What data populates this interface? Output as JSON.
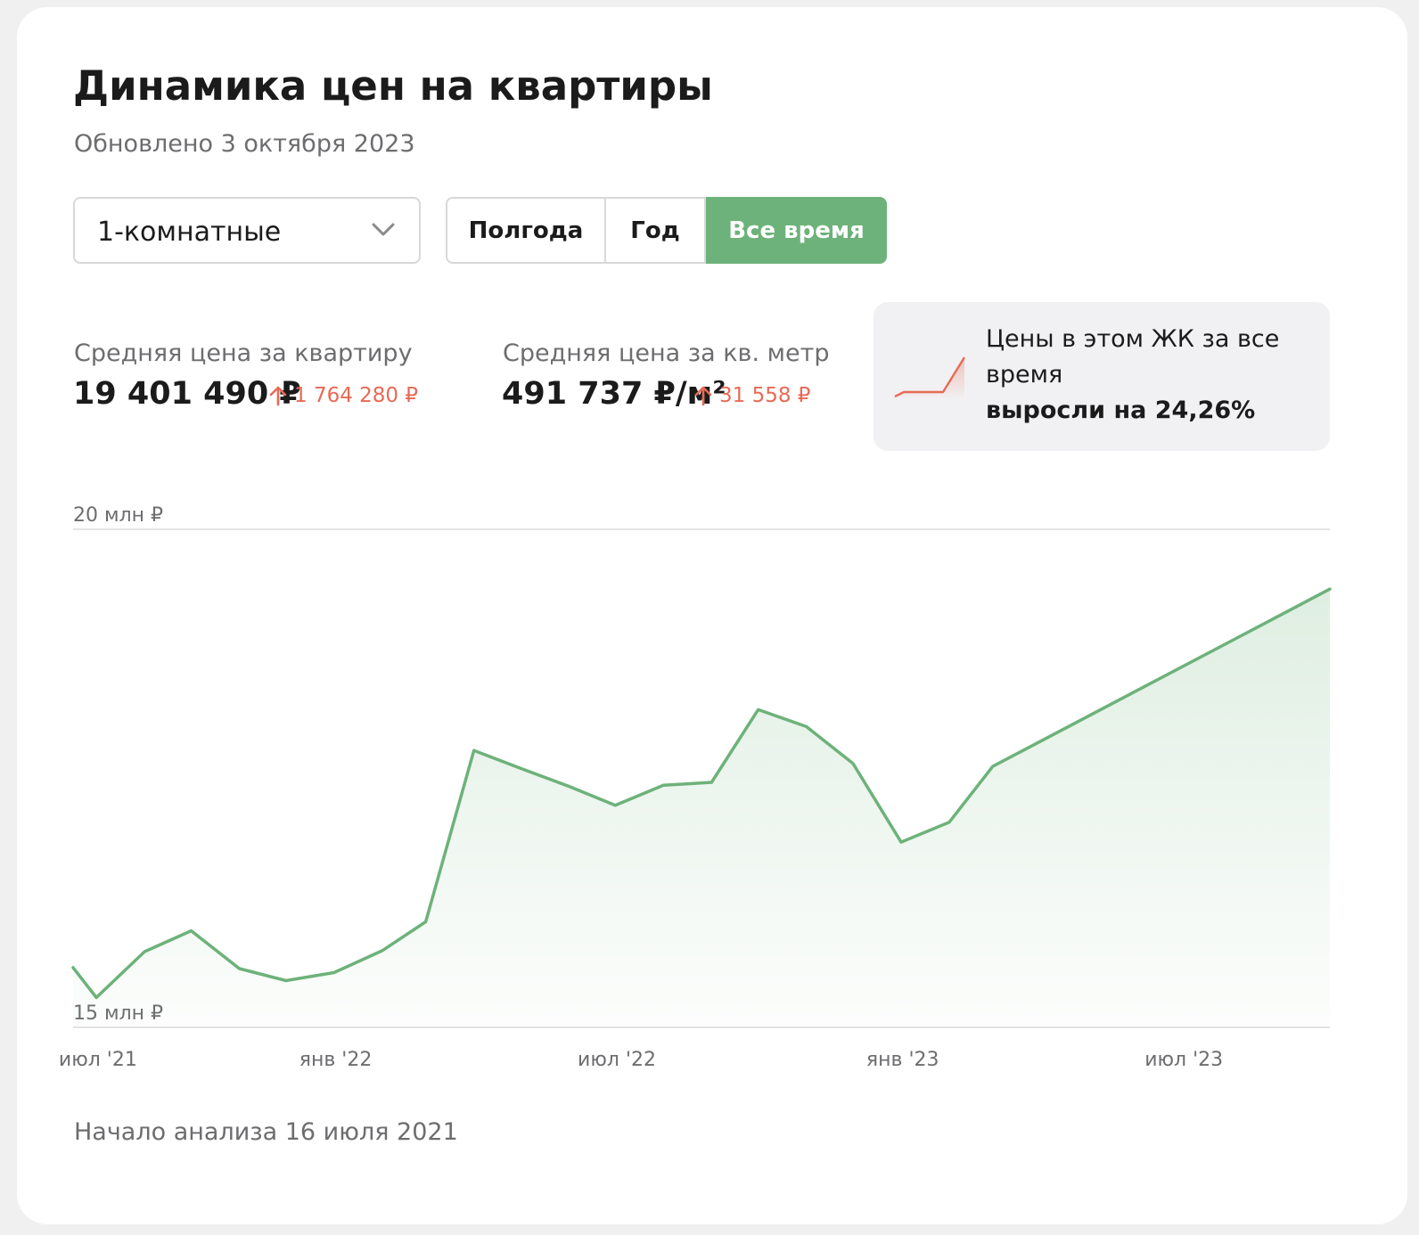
{
  "header": {
    "title": "Динамика цен на квартиры",
    "updated": "Обновлено 3 октября 2023"
  },
  "controls": {
    "room_select_value": "1-комнатные",
    "periods": [
      "Полгода",
      "Год",
      "Все время"
    ],
    "active_period": "Все время"
  },
  "stats": {
    "flat_price": {
      "label": "Средняя цена за квартиру",
      "value": "19 401 490 ₽",
      "delta": "1 764 280 ₽"
    },
    "sqm_price": {
      "label": "Средняя цена за кв. метр",
      "value": "491 737 ₽/м²",
      "delta": "31 558 ₽"
    },
    "delta_direction": "up"
  },
  "info": {
    "text": "Цены в этом ЖК за все время",
    "strong": "выросли на 24,26%"
  },
  "colors": {
    "accent": "#6db27a",
    "up": "#e86a55",
    "muted": "#6d6d70",
    "text": "#1b1b1c"
  },
  "chart_data": {
    "type": "area",
    "ylim": [
      15,
      20
    ],
    "y_tick_labels": [
      "20 млн ₽",
      "15 млн ₽"
    ],
    "x_tick_labels": [
      "июл '21",
      "янв '22",
      "июл '22",
      "янв '23",
      "июл '23"
    ],
    "xlim": [
      "2021-07-16",
      "2023-10-03"
    ],
    "x_ticks": [
      "2021-08-01",
      "2022-01-01",
      "2022-07-01",
      "2023-01-01",
      "2023-07-01"
    ],
    "x": [
      "2021-07-16",
      "2021-07-31",
      "2021-08-31",
      "2021-09-30",
      "2021-10-31",
      "2021-11-30",
      "2021-12-31",
      "2022-01-31",
      "2022-02-28",
      "2022-03-31",
      "2022-04-30",
      "2022-05-31",
      "2022-06-30",
      "2022-07-31",
      "2022-08-31",
      "2022-09-30",
      "2022-10-31",
      "2022-11-30",
      "2022-12-31",
      "2023-01-31",
      "2023-02-28",
      "2023-10-03"
    ],
    "values": [
      15.6,
      15.3,
      15.76,
      15.97,
      15.59,
      15.47,
      15.55,
      15.77,
      16.06,
      17.78,
      17.6,
      17.42,
      17.23,
      17.43,
      17.46,
      18.19,
      18.02,
      17.65,
      16.86,
      17.06,
      17.62,
      19.4
    ],
    "grid": true
  }
}
